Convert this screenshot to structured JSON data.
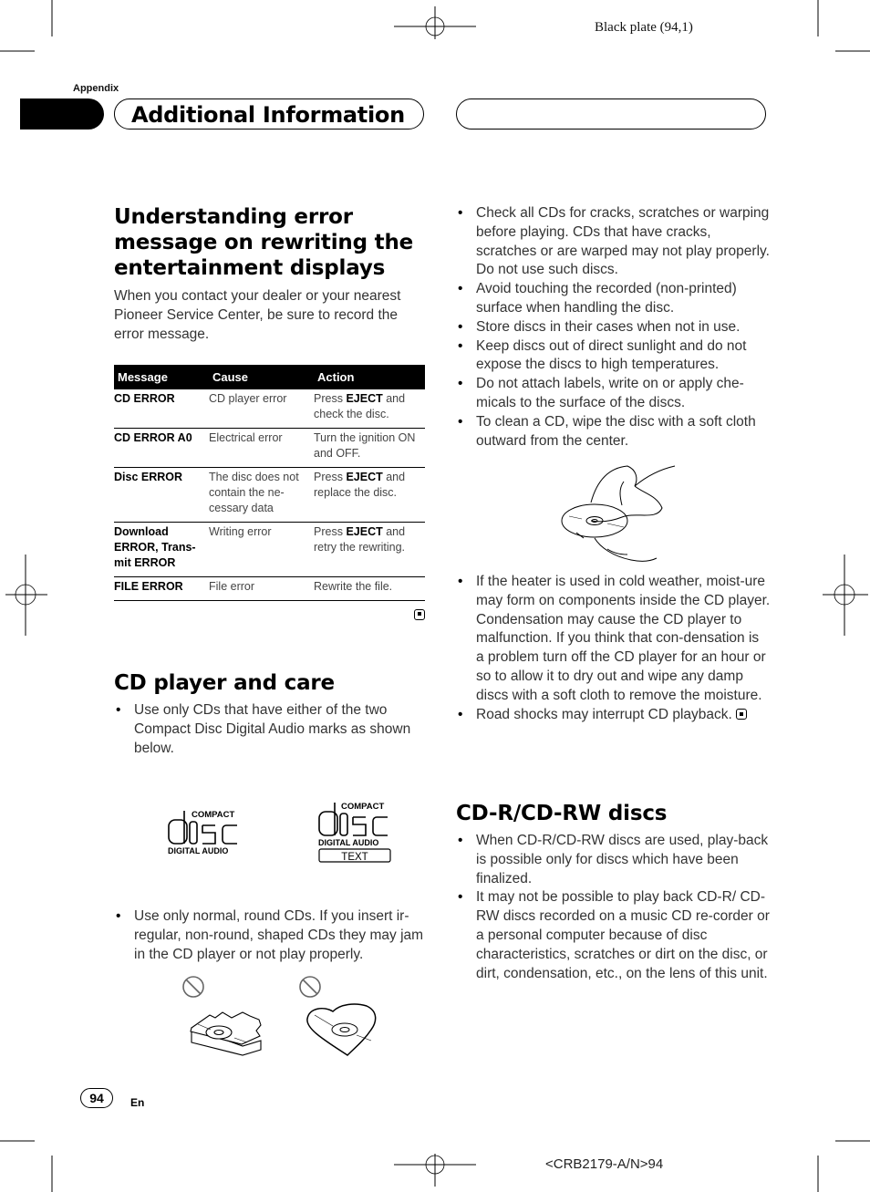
{
  "print_marks": {
    "plate_label": "Black plate (94,1)",
    "document_code": "<CRB2179-A/N>94"
  },
  "header": {
    "section_label": "Appendix",
    "tab_title": "Additional Information",
    "tab_right_label": ""
  },
  "error_section": {
    "title": "Understanding error message on rewriting the entertainment displays",
    "title_lines": [
      "Understanding error",
      "message on rewriting the",
      "entertainment displays"
    ],
    "intro": "When you contact your dealer or your nearest Pioneer Service Center, be sure to record the error message.",
    "table": {
      "columns": [
        "Message",
        "Cause",
        "Action"
      ],
      "rows": [
        {
          "message": "CD ERROR",
          "cause": "CD player error",
          "action_pre": "Press ",
          "action_key": "EJECT",
          "action_post": " and check the disc."
        },
        {
          "message": "CD ERROR A0",
          "cause": "Electrical error",
          "action_pre": "Turn the ignition ON and OFF.",
          "action_key": "",
          "action_post": ""
        },
        {
          "message": "Disc ERROR",
          "cause": "The disc does not contain the ne-cessary data",
          "action_pre": "Press ",
          "action_key": "EJECT",
          "action_post": " and replace the disc."
        },
        {
          "message": "Download ERROR, Trans-mit ERROR",
          "cause": "Writing error",
          "action_pre": "Press ",
          "action_key": "EJECT",
          "action_post": " and retry the rewriting."
        },
        {
          "message": "FILE ERROR",
          "cause": "File error",
          "action_pre": "Rewrite the file.",
          "action_key": "",
          "action_post": ""
        }
      ]
    }
  },
  "cd_care_section": {
    "title": "CD player and care",
    "bullets_top": [
      "Use only CDs that have either of the two Compact Disc Digital Audio marks as shown below."
    ],
    "logos": [
      {
        "top": "COMPACT",
        "main": "disc",
        "bottom": "DIGITAL AUDIO",
        "extra": ""
      },
      {
        "top": "COMPACT",
        "main": "disc",
        "bottom": "DIGITAL AUDIO",
        "extra": "TEXT"
      }
    ],
    "bullets_bottom": [
      "Use only normal, round CDs. If you insert ir-regular, non-round, shaped CDs they may jam in the CD player or not play properly."
    ],
    "right_bullets_top": [
      "Check all CDs for cracks, scratches or warping before playing. CDs that have cracks, scratches or are warped may not play properly. Do not use such discs.",
      "Avoid touching the recorded (non-printed) surface when handling the disc.",
      "Store discs in their cases when not in use.",
      "Keep discs out of direct sunlight and do not expose the discs to high temperatures.",
      "Do not attach labels, write on or apply che-micals to the surface of the discs.",
      "To clean a CD, wipe the disc with a soft cloth outward from the center."
    ],
    "right_bullets_bottom": [
      "If the heater is used in cold weather, moist-ure may form on components inside the CD player. Condensation may cause the CD player to malfunction. If you think that con-densation is a problem turn off the CD player for an hour or so to allow it to dry out and wipe any damp discs with a soft cloth to remove the moisture.",
      "Road shocks may interrupt CD playback."
    ]
  },
  "cdr_section": {
    "title": "CD-R/CD-RW discs",
    "bullets": [
      "When CD-R/CD-RW discs are used, play-back is possible only for discs which have been finalized.",
      "It may not be possible to play back CD-R/ CD-RW discs recorded on a music CD re-corder or a personal computer because of disc characteristics, scratches or dirt on the disc, or dirt, condensation, etc., on the lens of this unit."
    ]
  },
  "footer": {
    "page_number": "94",
    "language": "En"
  }
}
